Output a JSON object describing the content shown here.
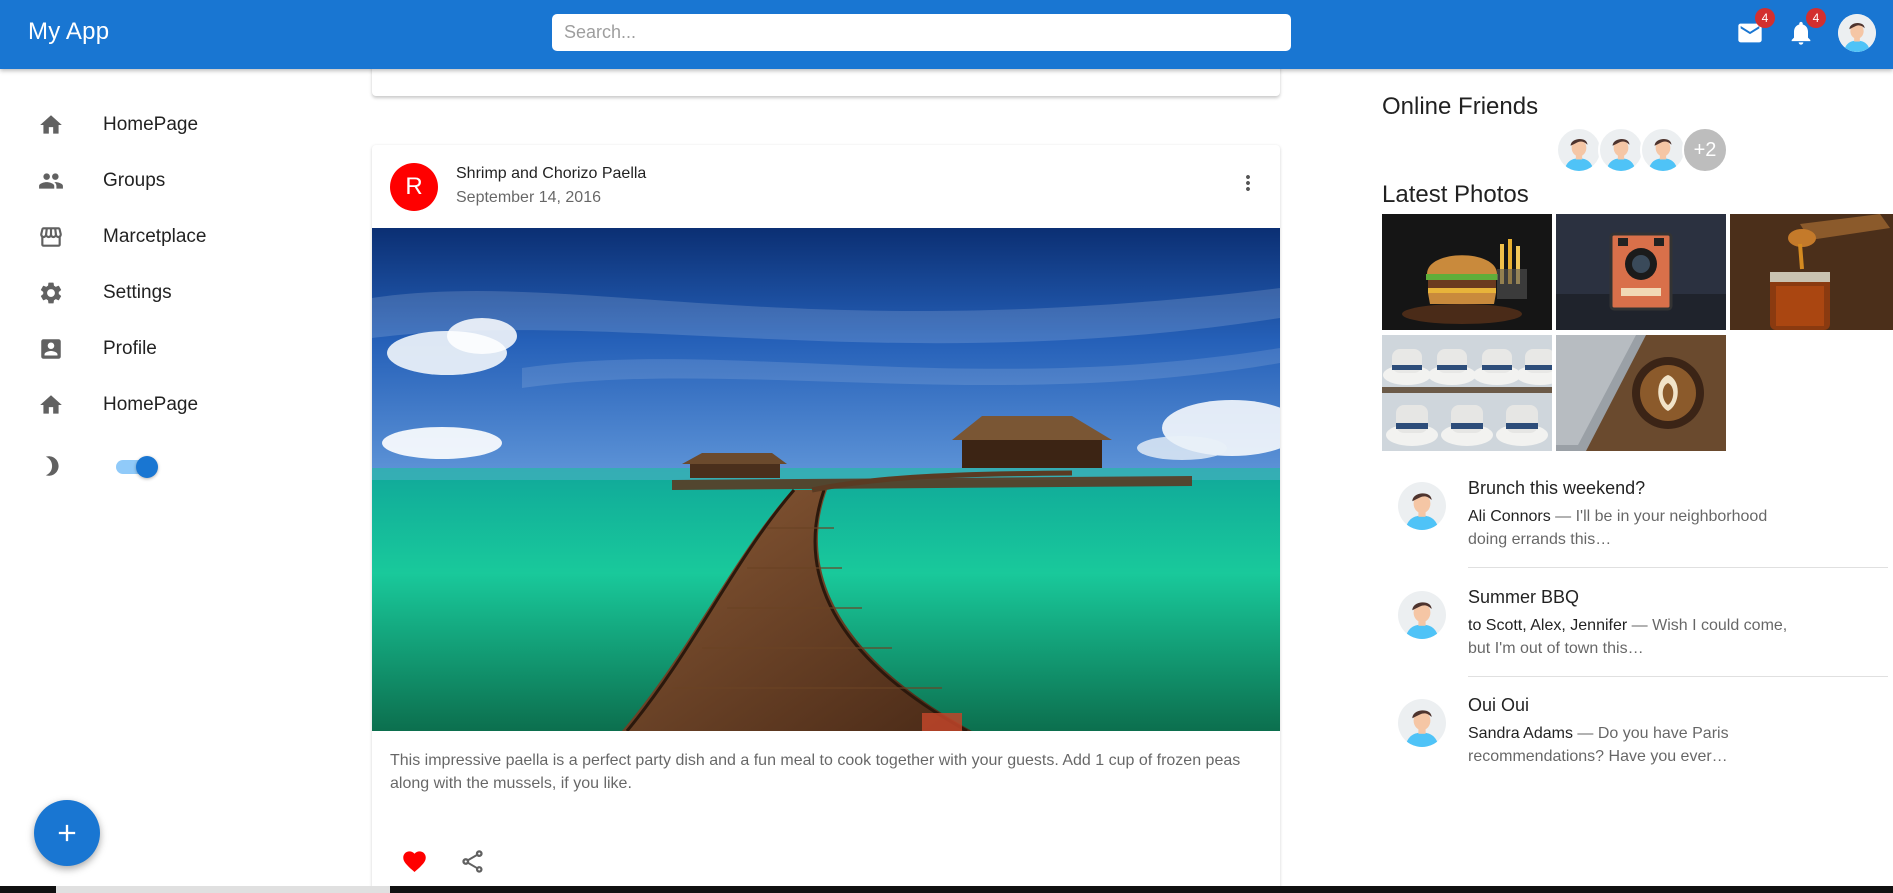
{
  "appbar": {
    "title": "My App",
    "search_placeholder": "Search...",
    "mail_badge": "4",
    "notifications_badge": "4",
    "color": "#1976d2"
  },
  "sidebar": {
    "items": [
      {
        "label": "HomePage",
        "icon": "home-icon"
      },
      {
        "label": "Groups",
        "icon": "groups-icon"
      },
      {
        "label": "Marcetplace",
        "icon": "storefront-icon"
      },
      {
        "label": "Settings",
        "icon": "settings-icon"
      },
      {
        "label": "Profile",
        "icon": "account-box-icon"
      },
      {
        "label": "HomePage",
        "icon": "home-icon"
      }
    ],
    "dark_mode_toggle": "on",
    "fab_icon": "add-icon"
  },
  "post": {
    "avatar_letter": "R",
    "avatar_color": "#ff0000",
    "title": "Shrimp and Chorizo Paella",
    "date": "September 14, 2016",
    "image": "tropical-pier-ocean-image",
    "body": "This impressive paella is a perfect party dish and a fun meal to cook together with your guests. Add 1 cup of frozen peas along with the mussels, if you like.",
    "like_color": "#ff0000"
  },
  "rightbar": {
    "online_title": "Online Friends",
    "online_extra": "+2",
    "photos_title": "Latest Photos",
    "photos": [
      "burger-photo",
      "vintage-camera-photo",
      "honey-jar-photo",
      "hats-photo",
      "latte-photo"
    ],
    "messages": [
      {
        "title": "Brunch this weekend?",
        "from": "Ali Connors",
        "text": " — I'll be in your neighborhood doing errands this…"
      },
      {
        "title": "Summer BBQ",
        "from": "to Scott, Alex, Jennifer",
        "text": " — Wish I could come, but I'm out of town this…"
      },
      {
        "title": "Oui Oui",
        "from": "Sandra Adams",
        "text": " — Do you have Paris recommendations? Have you ever…"
      }
    ]
  }
}
